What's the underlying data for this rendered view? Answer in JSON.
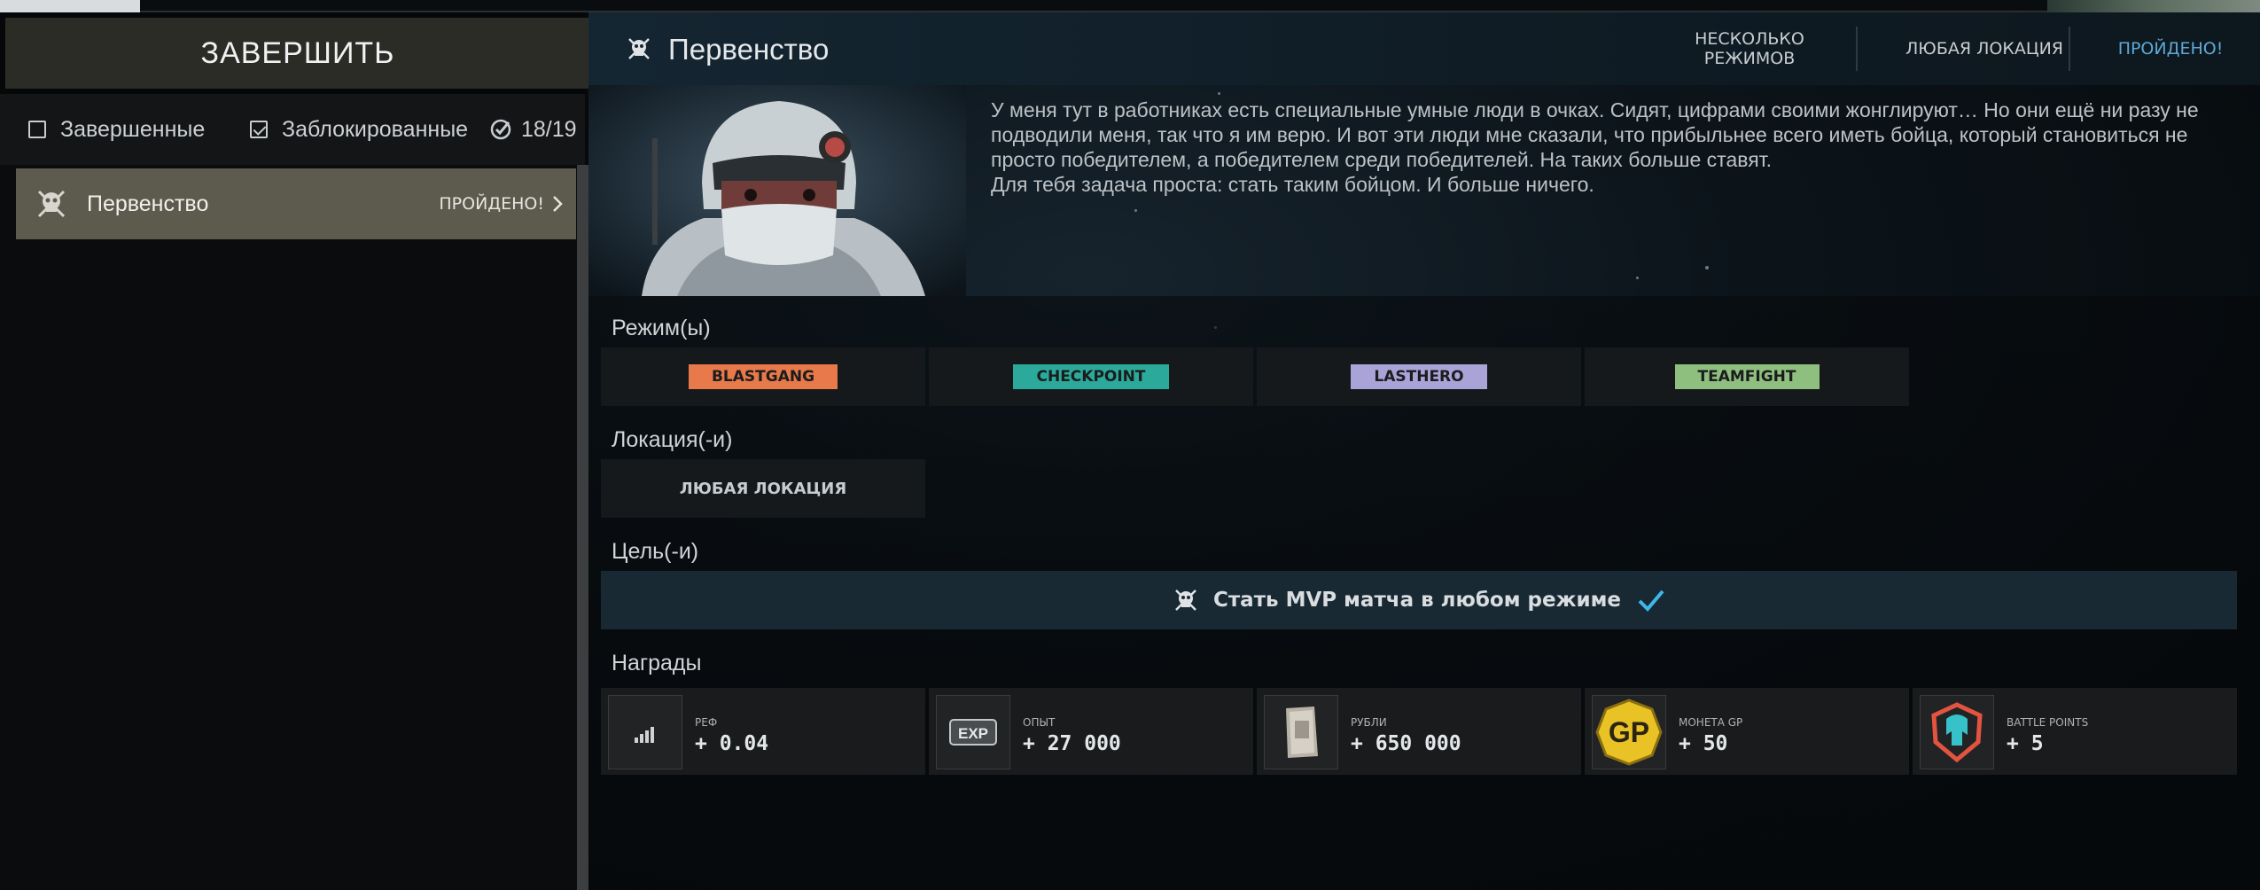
{
  "left": {
    "finish_label": "ЗАВЕРШИТЬ",
    "filters": {
      "completed": "Завершенные",
      "locked": "Заблокированные",
      "counter": "18/19"
    },
    "quests": [
      {
        "name": "Первенство",
        "status": "ПРОЙДЕНО!"
      }
    ]
  },
  "header": {
    "title": "Первенство",
    "tags": {
      "modes": "НЕСКОЛЬКО РЕЖИМОВ",
      "location": "ЛЮБАЯ ЛОКАЦИЯ",
      "status": "ПРОЙДЕНО!"
    }
  },
  "description": [
    "У меня тут в работниках есть специальные умные люди в очках. Сидят, цифрами своими жонглируют… Но они ещё ни разу не подводили меня, так что я им верю. И вот эти люди мне сказали, что прибыльнее всего иметь бойца, который становиться не просто победителем, а победителем среди победителей. На таких больше ставят.",
    "Для тебя задача проста: стать таким бойцом. И больше ничего."
  ],
  "sections": {
    "modes": "Режим(ы)",
    "locations": "Локация(-и)",
    "goals": "Цель(-и)",
    "rewards": "Награды"
  },
  "modes": [
    {
      "label": "BLASTGANG",
      "color": "#e8794a"
    },
    {
      "label": "CHECKPOINT",
      "color": "#2ba99a"
    },
    {
      "label": "LASTHERO",
      "color": "#a9a3d8"
    },
    {
      "label": "TEAMFIGHT",
      "color": "#8fbf7e"
    }
  ],
  "locations": [
    "ЛЮБАЯ ЛОКАЦИЯ"
  ],
  "goal": {
    "text": "Стать MVP матча в любом режиме",
    "completed": true,
    "check_color": "#3fb6e8"
  },
  "rewards": [
    {
      "label": "РЕФ",
      "value": "+ 0.04",
      "icon": "reputation-icon"
    },
    {
      "label": "ОПЫТ",
      "value": "+ 27 000",
      "icon": "exp-icon"
    },
    {
      "label": "РУБЛИ",
      "value": "+ 650 000",
      "icon": "rubles-icon"
    },
    {
      "label": "МОНЕТА GP",
      "value": "+ 50",
      "icon": "gp-coin-icon"
    },
    {
      "label": "BATTLE POINTS",
      "value": "+ 5",
      "icon": "battle-points-icon"
    }
  ],
  "colors": {
    "accent_blue": "#5ea9d6",
    "quest_selected_bg": "#5d5b4e",
    "header_bg": "#142632"
  }
}
